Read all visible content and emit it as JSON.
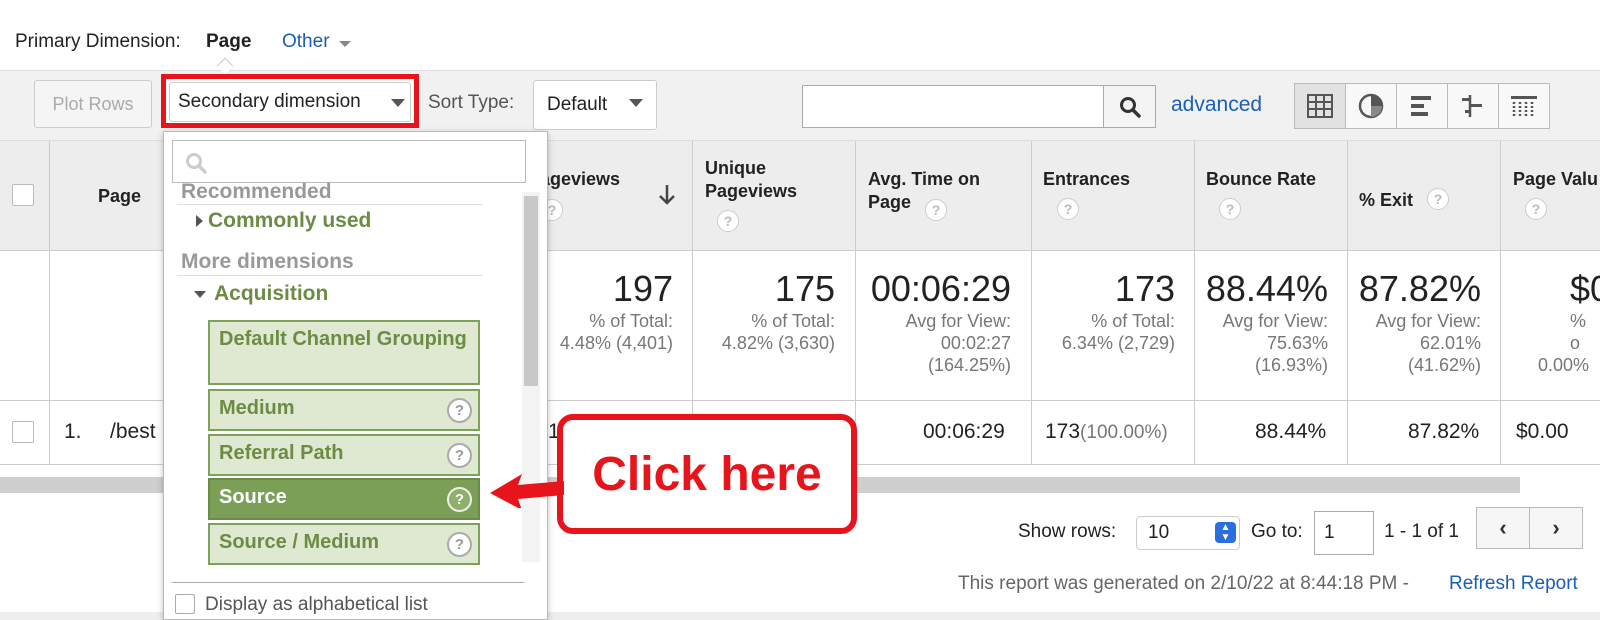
{
  "primary_dimension": {
    "label": "Primary Dimension:",
    "value": "Page",
    "other": "Other"
  },
  "toolbar": {
    "plot_rows": "Plot Rows",
    "secondary_dimension": "Secondary dimension",
    "sort_type_label": "Sort Type:",
    "sort_type_value": "Default",
    "search_value": "",
    "advanced": "advanced",
    "view_icons": [
      "grid-icon",
      "pie-icon",
      "bar-icon",
      "comparison-icon",
      "pivot-icon"
    ]
  },
  "table": {
    "headers": {
      "page": "Page",
      "pageviews": "ageviews",
      "unique_pageviews": "Unique Pageviews",
      "avg_time": "Avg. Time on Page",
      "entrances": "Entrances",
      "bounce_rate": "Bounce Rate",
      "exit": "% Exit",
      "page_value": "Page Valu"
    },
    "totals": {
      "pageviews": {
        "value": "197",
        "sub1": "% of Total:",
        "sub2": "4.48% (4,401)"
      },
      "unique_pageviews": {
        "value": "175",
        "sub1": "% of Total:",
        "sub2": "4.82% (3,630)"
      },
      "avg_time": {
        "value": "00:06:29",
        "sub1": "Avg for View:",
        "sub2": "00:02:27",
        "sub3": "(164.25%)"
      },
      "entrances": {
        "value": "173",
        "sub1": "% of Total:",
        "sub2": "6.34% (2,729)"
      },
      "bounce_rate": {
        "value": "88.44%",
        "sub1": "Avg for View:",
        "sub2": "75.63%",
        "sub3": "(16.93%)"
      },
      "exit": {
        "value": "87.82%",
        "sub1": "Avg for View:",
        "sub2": "62.01%",
        "sub3": "(41.62%)"
      },
      "page_value": {
        "value": "$0",
        "sub1": "% o",
        "sub2": "0.00%"
      }
    },
    "rows": [
      {
        "index": "1.",
        "page": "/best",
        "pageviews_partial": "1",
        "avg_time": "00:06:29",
        "entrances": "173",
        "entrances_pct": "(100.00%)",
        "bounce_rate": "88.44%",
        "exit": "87.82%",
        "page_value": "$0.00"
      }
    ]
  },
  "dropdown": {
    "search_placeholder": "",
    "section_recommended": "Recommended",
    "commonly_used": "Commonly used",
    "section_more": "More dimensions",
    "acquisition": "Acquisition",
    "items": [
      {
        "label": "Default Channel Grouping",
        "help": false,
        "selected": false
      },
      {
        "label": "Medium",
        "help": true,
        "selected": false
      },
      {
        "label": "Referral Path",
        "help": true,
        "selected": false
      },
      {
        "label": "Source",
        "help": true,
        "selected": true
      },
      {
        "label": "Source / Medium",
        "help": true,
        "selected": false
      }
    ],
    "alphabetical": "Display as alphabetical list"
  },
  "footer": {
    "show_rows_label": "Show rows:",
    "show_rows_value": "10",
    "goto_label": "Go to:",
    "goto_value": "1",
    "range": "1 - 1 of 1",
    "generated": "This report was generated on 2/10/22 at 8:44:18 PM -",
    "refresh": "Refresh Report"
  },
  "callout": {
    "text": "Click here",
    "color": "#e8141c"
  },
  "colors": {
    "accent_red": "#e8141c",
    "link_blue": "#1a5fb4",
    "green": "#6c8c46"
  }
}
